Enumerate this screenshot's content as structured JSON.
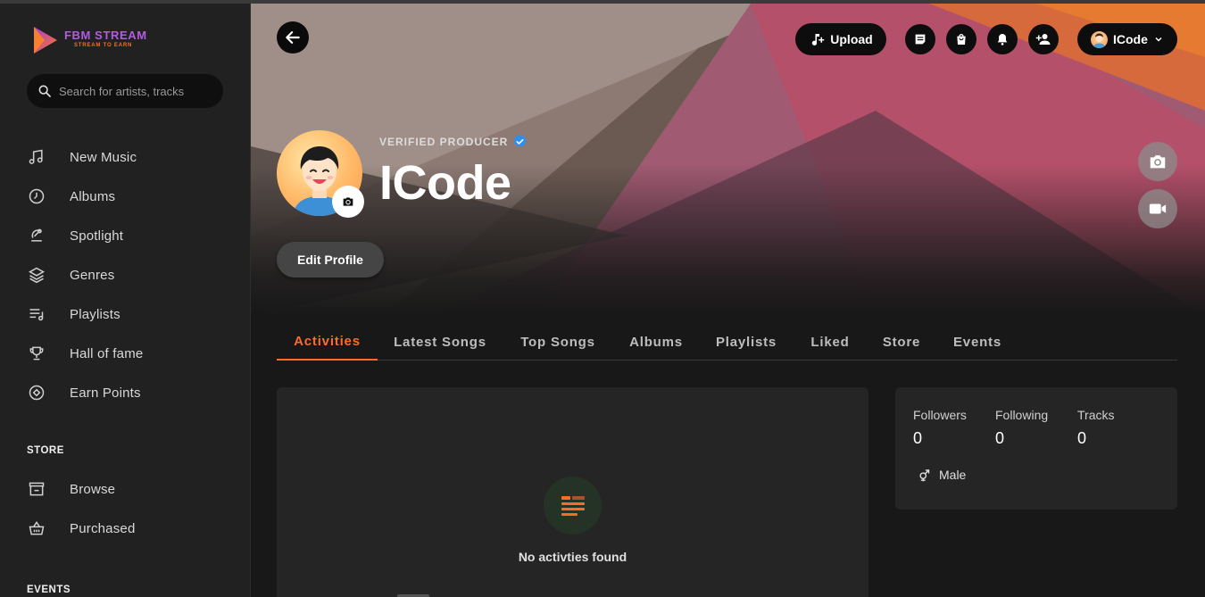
{
  "app": {
    "logo_title": "FBM STREAM",
    "logo_subtitle": "STREAM TO EARN",
    "accent": "#ff6a2a"
  },
  "search": {
    "placeholder": "Search for artists, tracks"
  },
  "nav": [
    {
      "label": "New Music",
      "icon": "music-note-icon"
    },
    {
      "label": "Albums",
      "icon": "album-icon"
    },
    {
      "label": "Spotlight",
      "icon": "spotlight-icon"
    },
    {
      "label": "Genres",
      "icon": "layers-icon"
    },
    {
      "label": "Playlists",
      "icon": "playlist-icon"
    },
    {
      "label": "Hall of fame",
      "icon": "trophy-icon"
    },
    {
      "label": "Earn Points",
      "icon": "coin-icon"
    }
  ],
  "store": {
    "title": "STORE",
    "items": [
      {
        "label": "Browse",
        "icon": "store-icon"
      },
      {
        "label": "Purchased",
        "icon": "basket-icon"
      }
    ]
  },
  "events_section": {
    "title": "EVENTS"
  },
  "header": {
    "upload_label": "Upload",
    "user_label": "ICode"
  },
  "profile": {
    "badge": "VERIFIED PRODUCER",
    "name": "ICode",
    "edit_label": "Edit Profile"
  },
  "tabs": [
    {
      "label": "Activities",
      "active": true
    },
    {
      "label": "Latest Songs"
    },
    {
      "label": "Top Songs"
    },
    {
      "label": "Albums"
    },
    {
      "label": "Playlists"
    },
    {
      "label": "Liked"
    },
    {
      "label": "Store"
    },
    {
      "label": "Events"
    }
  ],
  "activity": {
    "empty_text": "No activties found"
  },
  "stats": {
    "followers_label": "Followers",
    "followers": "0",
    "following_label": "Following",
    "following": "0",
    "tracks_label": "Tracks",
    "tracks": "0",
    "gender": "Male"
  }
}
